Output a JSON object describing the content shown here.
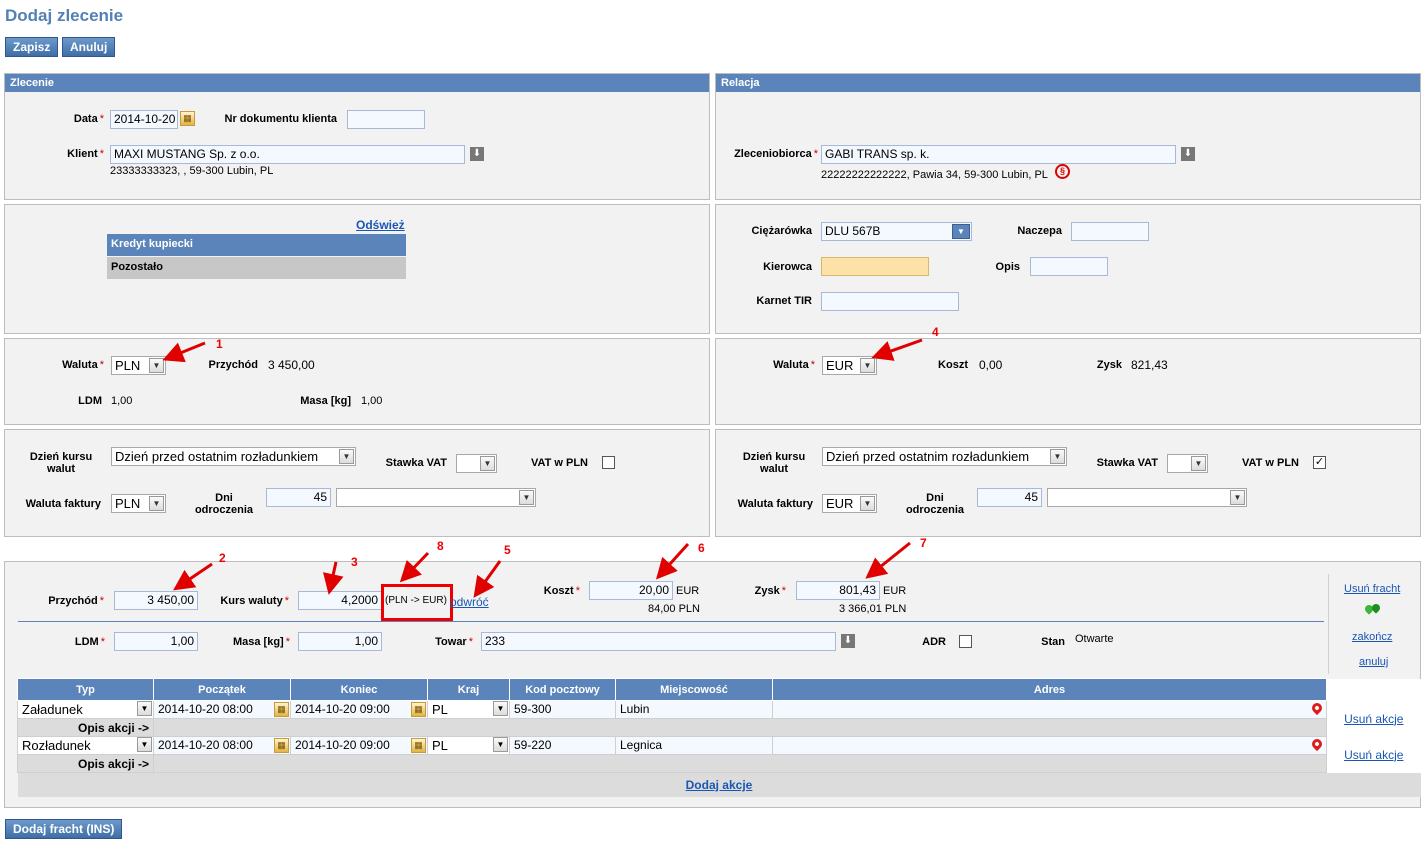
{
  "header": {
    "title": "Dodaj zlecenie",
    "save": "Zapisz",
    "cancel": "Anuluj"
  },
  "order": {
    "heading": "Zlecenie",
    "date_label": "Data",
    "date_value": "2014-10-20",
    "doc_label": "Nr dokumentu klienta",
    "doc_value": "",
    "client_label": "Klient",
    "client_value": "MAXI MUSTANG Sp. z o.o.",
    "client_info": "23333333323, , 59-300 Lubin, PL"
  },
  "relation": {
    "heading": "Relacja",
    "contractor_label": "Zleceniobiorca",
    "contractor_value": "GABI TRANS sp. k.",
    "contractor_info": "22222222222222, Pawia 34, 59-300 Lubin, PL"
  },
  "credit": {
    "refresh": "Odśwież",
    "row1": "Kredyt kupiecki",
    "row2": "Pozostało"
  },
  "vehicle": {
    "truck_label": "Ciężarówka",
    "truck_value": "DLU 567B",
    "trailer_label": "Naczepa",
    "trailer_value": "",
    "driver_label": "Kierowca",
    "driver_value": "",
    "desc_label": "Opis",
    "desc_value": "",
    "tir_label": "Karnet TIR",
    "tir_value": ""
  },
  "left_currency": {
    "currency_label": "Waluta",
    "currency_value": "PLN",
    "income_label": "Przychód",
    "income_value": "3 450,00",
    "ldm_label": "LDM",
    "ldm_value": "1,00",
    "mass_label": "Masa [kg]",
    "mass_value": "1,00"
  },
  "right_currency": {
    "currency_label": "Waluta",
    "currency_value": "EUR",
    "cost_label": "Koszt",
    "cost_value": "0,00",
    "profit_label": "Zysk",
    "profit_value": "821,43"
  },
  "left_invoice": {
    "rate_day_label_1": "Dzień kursu",
    "rate_day_label_2": "walut",
    "rate_day_value": "Dzień przed ostatnim rozładunkiem",
    "vat_label": "Stawka VAT",
    "vat_value": "",
    "vat_pln_label": "VAT w PLN",
    "vat_pln_checked": "",
    "inv_currency_label": "Waluta faktury",
    "inv_currency_value": "PLN",
    "days_label_1": "Dni",
    "days_label_2": "odroczenia",
    "days_value": "45"
  },
  "right_invoice": {
    "rate_day_label_1": "Dzień kursu",
    "rate_day_label_2": "walut",
    "rate_day_value": "Dzień przed ostatnim rozładunkiem",
    "vat_label": "Stawka VAT",
    "vat_value": "",
    "vat_pln_label": "VAT w PLN",
    "vat_pln_checked": "✓",
    "inv_currency_label": "Waluta faktury",
    "inv_currency_value": "EUR",
    "days_label_1": "Dni",
    "days_label_2": "odroczenia",
    "days_value": "45"
  },
  "freight": {
    "income_label": "Przychód",
    "income_value": "3 450,00",
    "rate_label": "Kurs waluty",
    "rate_value": "4,2000",
    "conversion": "(PLN -> EUR)",
    "reverse": "odwróć",
    "cost_label": "Koszt",
    "cost_value": "20,00",
    "cost_currency": "EUR",
    "cost_pln": "84,00 PLN",
    "profit_label": "Zysk",
    "profit_value": "801,43",
    "profit_currency": "EUR",
    "profit_pln": "3 366,01 PLN",
    "ldm_label": "LDM",
    "ldm_value": "1,00",
    "mass_label": "Masa [kg]",
    "mass_value": "1,00",
    "goods_label": "Towar",
    "goods_value": "233",
    "adr_label": "ADR",
    "status_label": "Stan",
    "status_value": "Otwarte",
    "remove": "Usuń fracht",
    "finish": "zakończ",
    "cancel": "anuluj"
  },
  "actions": {
    "headers": [
      "Typ",
      "Początek",
      "Koniec",
      "Kraj",
      "Kod pocztowy",
      "Miejscowość",
      "Adres"
    ],
    "rows": [
      {
        "type": "Załadunek",
        "start": "2014-10-20 08:00",
        "end": "2014-10-20 09:00",
        "country": "PL",
        "postal": "59-300",
        "city": "Lubin",
        "address": "",
        "desc": "Opis akcji ->",
        "remove": "Usuń akcje"
      },
      {
        "type": "Rozładunek",
        "start": "2014-10-20 08:00",
        "end": "2014-10-20 09:00",
        "country": "PL",
        "postal": "59-220",
        "city": "Legnica",
        "address": "",
        "desc": "Opis akcji ->",
        "remove": "Usuń akcje"
      }
    ],
    "add": "Dodaj akcje"
  },
  "footer": {
    "add_freight": "Dodaj fracht (INS)"
  },
  "annotations": [
    "1",
    "2",
    "3",
    "4",
    "5",
    "6",
    "7",
    "8"
  ],
  "colors": {
    "panel_header": "#5b84bb",
    "annotation": "#e00000",
    "driver_field": "#fde2a8"
  }
}
